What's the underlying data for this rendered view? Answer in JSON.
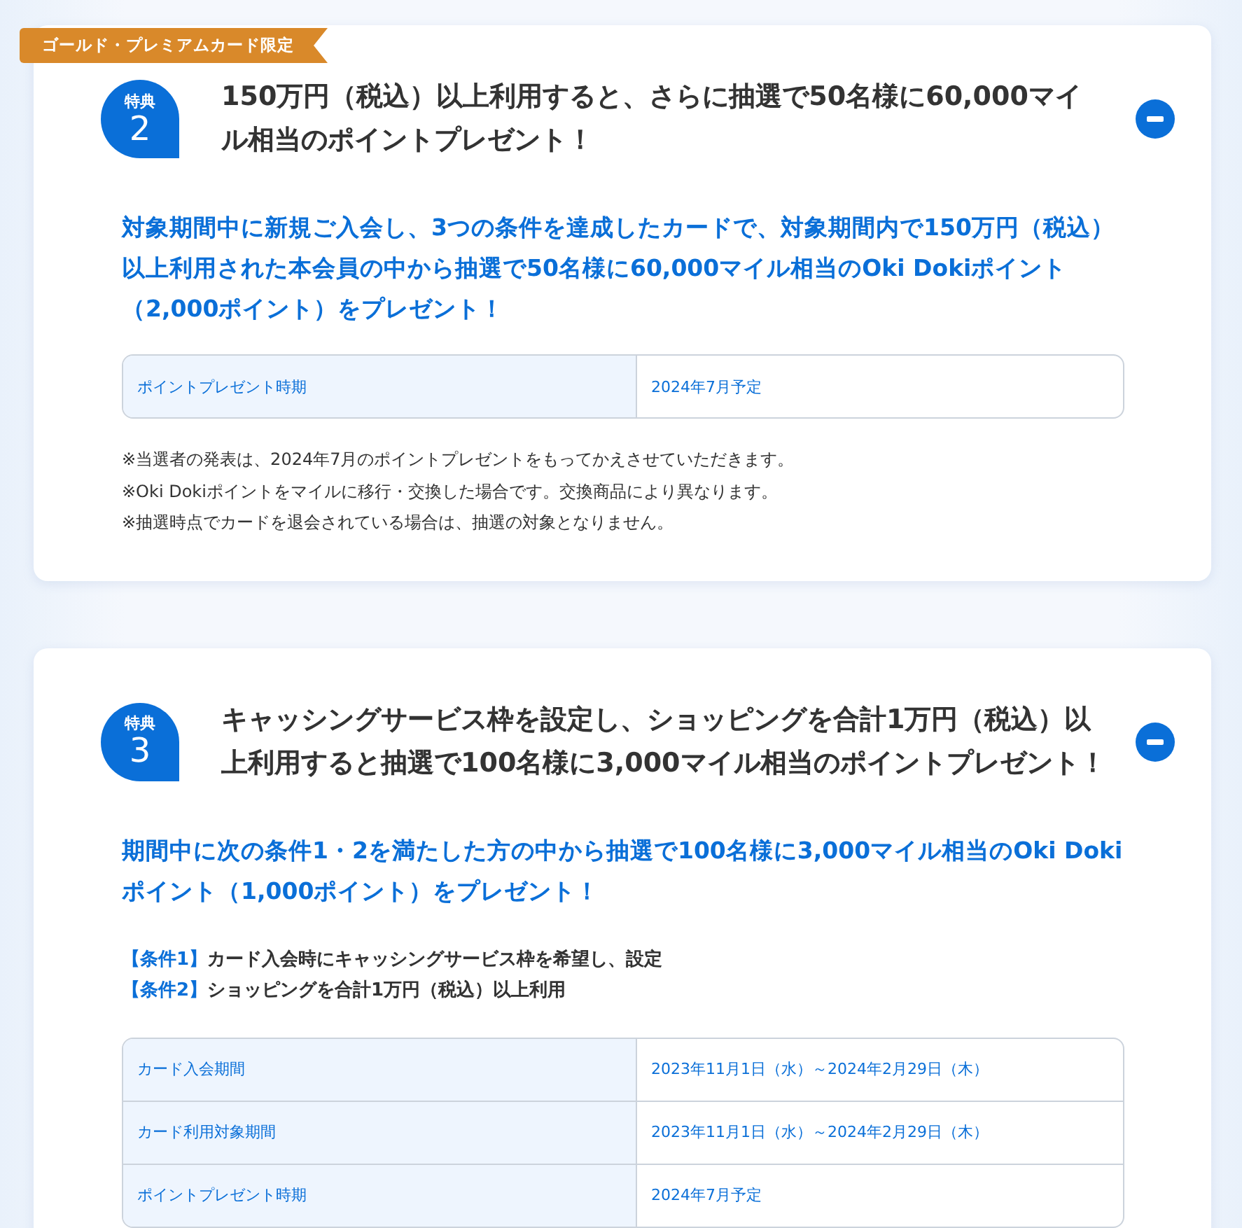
{
  "cards": [
    {
      "ribbon": "ゴールド・プレミアムカード限定",
      "badge_label": "特典",
      "badge_number": "2",
      "title": "150万円（税込）以上利用すると、さらに抽選で50名様に60,000マイル相当のポイントプレゼント！",
      "expanded": true,
      "lead": "対象期間中に新規ご入会し、3つの条件を達成したカードで、対象期間内で150万円（税込）以上利用された本会員の中から抽選で50名様に60,000マイル相当のOki Dokiポイント（2,000ポイント）をプレゼント！",
      "rows": [
        {
          "label": "ポイントプレゼント時期",
          "value": "2024年7月予定"
        }
      ],
      "notes": [
        "※当選者の発表は、2024年7月のポイントプレゼントをもってかえさせていただきます。",
        "※Oki Dokiポイントをマイルに移行・交換した場合です。交換商品により異なります。",
        "※抽選時点でカードを退会されている場合は、抽選の対象となりません。"
      ]
    },
    {
      "badge_label": "特典",
      "badge_number": "3",
      "title": "キャッシングサービス枠を設定し、ショッピングを合計1万円（税込）以上利用すると抽選で100名様に3,000マイル相当のポイントプレゼント！",
      "expanded": true,
      "lead": "期間中に次の条件1・2を満たした方の中から抽選で100名様に3,000マイル相当のOki Dokiポイント（1,000ポイント）をプレゼント！",
      "conditions": [
        {
          "label": "【条件1】",
          "text": "カード入会時にキャッシングサービス枠を希望し、設定"
        },
        {
          "label": "【条件2】",
          "text": "ショッピングを合計1万円（税込）以上利用"
        }
      ],
      "rows": [
        {
          "label": "カード入会期間",
          "value": "2023年11月1日（水）～2024年2月29日（木）"
        },
        {
          "label": "カード利用対象期間",
          "value": "2023年11月1日（水）～2024年2月29日（木）"
        },
        {
          "label": "ポイントプレゼント時期",
          "value": "2024年7月予定"
        }
      ]
    }
  ]
}
